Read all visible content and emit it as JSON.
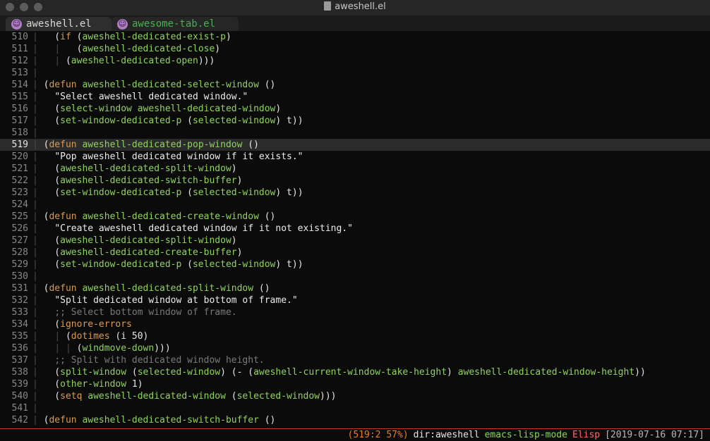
{
  "window": {
    "title": "aweshell.el"
  },
  "tabs": [
    {
      "label": "aweshell.el",
      "active": true
    },
    {
      "label": "awesome-tab.el",
      "active": false
    }
  ],
  "editor": {
    "current_line": "519",
    "lines": [
      {
        "num": "510",
        "text": "  (if (aweshell-dedicated-exist-p)"
      },
      {
        "num": "511",
        "text": "  |   (aweshell-dedicated-close)"
      },
      {
        "num": "512",
        "text": "  | (aweshell-dedicated-open)))"
      },
      {
        "num": "513",
        "text": ""
      },
      {
        "num": "514",
        "text": "(defun aweshell-dedicated-select-window ()"
      },
      {
        "num": "515",
        "text": "  \"Select aweshell dedicated window.\""
      },
      {
        "num": "516",
        "text": "  (select-window aweshell-dedicated-window)"
      },
      {
        "num": "517",
        "text": "  (set-window-dedicated-p (selected-window) t))"
      },
      {
        "num": "518",
        "text": ""
      },
      {
        "num": "519",
        "text": "(defun aweshell-dedicated-pop-window ()"
      },
      {
        "num": "520",
        "text": "  \"Pop aweshell dedicated window if it exists.\""
      },
      {
        "num": "521",
        "text": "  (aweshell-dedicated-split-window)"
      },
      {
        "num": "522",
        "text": "  (aweshell-dedicated-switch-buffer)"
      },
      {
        "num": "523",
        "text": "  (set-window-dedicated-p (selected-window) t))"
      },
      {
        "num": "524",
        "text": ""
      },
      {
        "num": "525",
        "text": "(defun aweshell-dedicated-create-window ()"
      },
      {
        "num": "526",
        "text": "  \"Create aweshell dedicated window if it not existing.\""
      },
      {
        "num": "527",
        "text": "  (aweshell-dedicated-split-window)"
      },
      {
        "num": "528",
        "text": "  (aweshell-dedicated-create-buffer)"
      },
      {
        "num": "529",
        "text": "  (set-window-dedicated-p (selected-window) t))"
      },
      {
        "num": "530",
        "text": ""
      },
      {
        "num": "531",
        "text": "(defun aweshell-dedicated-split-window ()"
      },
      {
        "num": "532",
        "text": "  \"Split dedicated window at bottom of frame.\""
      },
      {
        "num": "533",
        "text": "  ;; Select bottom window of frame."
      },
      {
        "num": "534",
        "text": "  (ignore-errors"
      },
      {
        "num": "535",
        "text": "  | (dotimes (i 50)"
      },
      {
        "num": "536",
        "text": "  | | (windmove-down)))"
      },
      {
        "num": "537",
        "text": "  ;; Split with dedicated window height."
      },
      {
        "num": "538",
        "text": "  (split-window (selected-window) (- (aweshell-current-window-take-height) aweshell-dedicated-window-height))"
      },
      {
        "num": "539",
        "text": "  (other-window 1)"
      },
      {
        "num": "540",
        "text": "  (setq aweshell-dedicated-window (selected-window)))"
      },
      {
        "num": "541",
        "text": ""
      },
      {
        "num": "542",
        "text": "(defun aweshell-dedicated-switch-buffer ()"
      }
    ]
  },
  "modeline": {
    "position": "(519:2 57%)",
    "dir": "dir:aweshell",
    "mode": "emacs-lisp-mode",
    "lang": "Elisp",
    "datetime": "[2019-07-16 07:17]"
  },
  "colors": {
    "background": "#0b0b0b",
    "keyword": "#d89b55",
    "function_name": "#ff6b6b",
    "symbol": "#90d35f",
    "comment": "#7a7a7a",
    "modeline_border": "#c0392b"
  }
}
